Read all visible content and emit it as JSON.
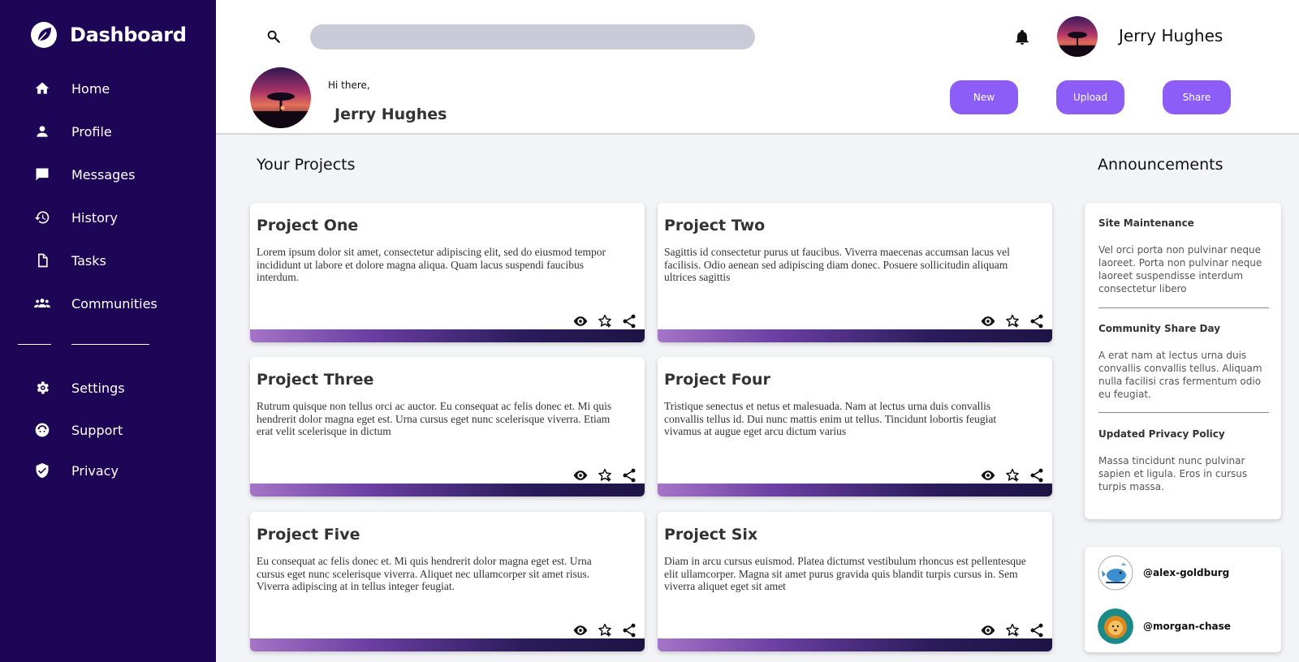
{
  "brand": {
    "name": "Dashboard",
    "icon": "leaf-icon"
  },
  "sidebar": {
    "items": [
      {
        "label": "Home",
        "icon": "home-icon"
      },
      {
        "label": "Profile",
        "icon": "person-icon"
      },
      {
        "label": "Messages",
        "icon": "chat-icon"
      },
      {
        "label": "History",
        "icon": "history-icon"
      },
      {
        "label": "Tasks",
        "icon": "document-icon"
      },
      {
        "label": "Communities",
        "icon": "group-icon"
      }
    ],
    "bottom_items": [
      {
        "label": "Settings",
        "icon": "gear-icon"
      },
      {
        "label": "Support",
        "icon": "support-icon"
      },
      {
        "label": "Privacy",
        "icon": "shield-icon"
      }
    ]
  },
  "header": {
    "search_placeholder": "",
    "user_name": "Jerry Hughes"
  },
  "hero": {
    "greeting": "Hi there,",
    "user_name": "Jerry Hughes",
    "buttons": {
      "new": "New",
      "upload": "Upload",
      "share": "Share"
    }
  },
  "projects": {
    "title": "Your Projects",
    "items": [
      {
        "title": "Project One",
        "description": "Lorem ipsum dolor sit amet, consectetur adipiscing elit, sed do eiusmod tempor incididunt ut labore et dolore magna aliqua. Quam lacus suspendi faucibus interdum."
      },
      {
        "title": "Project Two",
        "description": "Sagittis id consectetur purus ut faucibus. Viverra maecenas accumsan lacus vel facilisis. Odio aenean sed adipiscing diam donec. Posuere sollicitudin aliquam ultrices sagittis"
      },
      {
        "title": "Project Three",
        "description": "Rutrum quisque non tellus orci ac auctor. Eu consequat ac felis donec et. Mi quis hendrerit dolor magna eget est. Urna cursus eget nunc scelerisque viverra. Etiam erat velit scelerisque in dictum"
      },
      {
        "title": "Project Four",
        "description": "Tristique senectus et netus et malesuada. Nam at lectus urna duis convallis convallis tellus id. Dui nunc mattis enim ut tellus. Tincidunt lobortis feugiat vivamus at augue eget arcu dictum varius"
      },
      {
        "title": "Project Five",
        "description": "Eu consequat ac felis donec et. Mi quis hendrerit dolor magna eget est. Urna cursus eget nunc scelerisque viverra. Aliquet nec ullamcorper sit amet risus. Viverra adipiscing at in tellus integer feugiat."
      },
      {
        "title": "Project Six",
        "description": "Diam in arcu cursus euismod. Platea dictumst vestibulum rhoncus est pellentesque elit ullamcorper. Magna sit amet purus gravida quis blandit turpis cursus in. Sem viverra aliquet eget sit amet"
      }
    ]
  },
  "announcements": {
    "title": "Announcements",
    "items": [
      {
        "title": "Site Maintenance",
        "body": "Vel orci porta non pulvinar neque laoreet. Porta non pulvinar neque laoreet suspendisse interdum consectetur libero"
      },
      {
        "title": "Community Share Day",
        "body": "A erat nam at lectus urna duis convallis convallis tellus. Aliquam nulla facilisi cras fermentum odio eu feugiat."
      },
      {
        "title": "Updated Privacy Policy",
        "body": "Massa tincidunt nunc pulvinar sapien et ligula. Eros in cursus turpis massa."
      }
    ]
  },
  "contacts": [
    {
      "handle": "@alex-goldburg",
      "avatar": "whale-avatar"
    },
    {
      "handle": "@morgan-chase",
      "avatar": "lion-avatar"
    }
  ],
  "colors": {
    "sidebar_bg": "#1d0656",
    "accent": "#8d5ef7",
    "search_bg": "#c9cbd9",
    "page_bg": "#f3f4f8"
  }
}
